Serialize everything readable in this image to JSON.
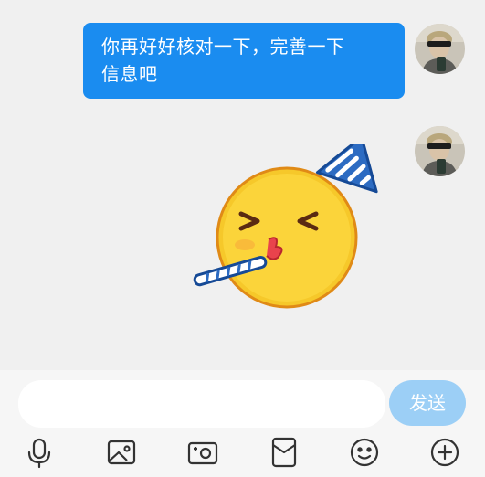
{
  "message": {
    "line1": "你再好好核对一下，完善一下",
    "line2": "信息吧"
  },
  "composer": {
    "input_value": "",
    "send_label": "发送"
  },
  "toolbar": {
    "icons": [
      "microphone-icon",
      "image-icon",
      "camera-icon",
      "red-packet-icon",
      "emoji-icon",
      "plus-icon"
    ]
  },
  "colors": {
    "bubble": "#1a8cf0",
    "send_button": "#9ccff6",
    "background": "#f0f0f0"
  }
}
